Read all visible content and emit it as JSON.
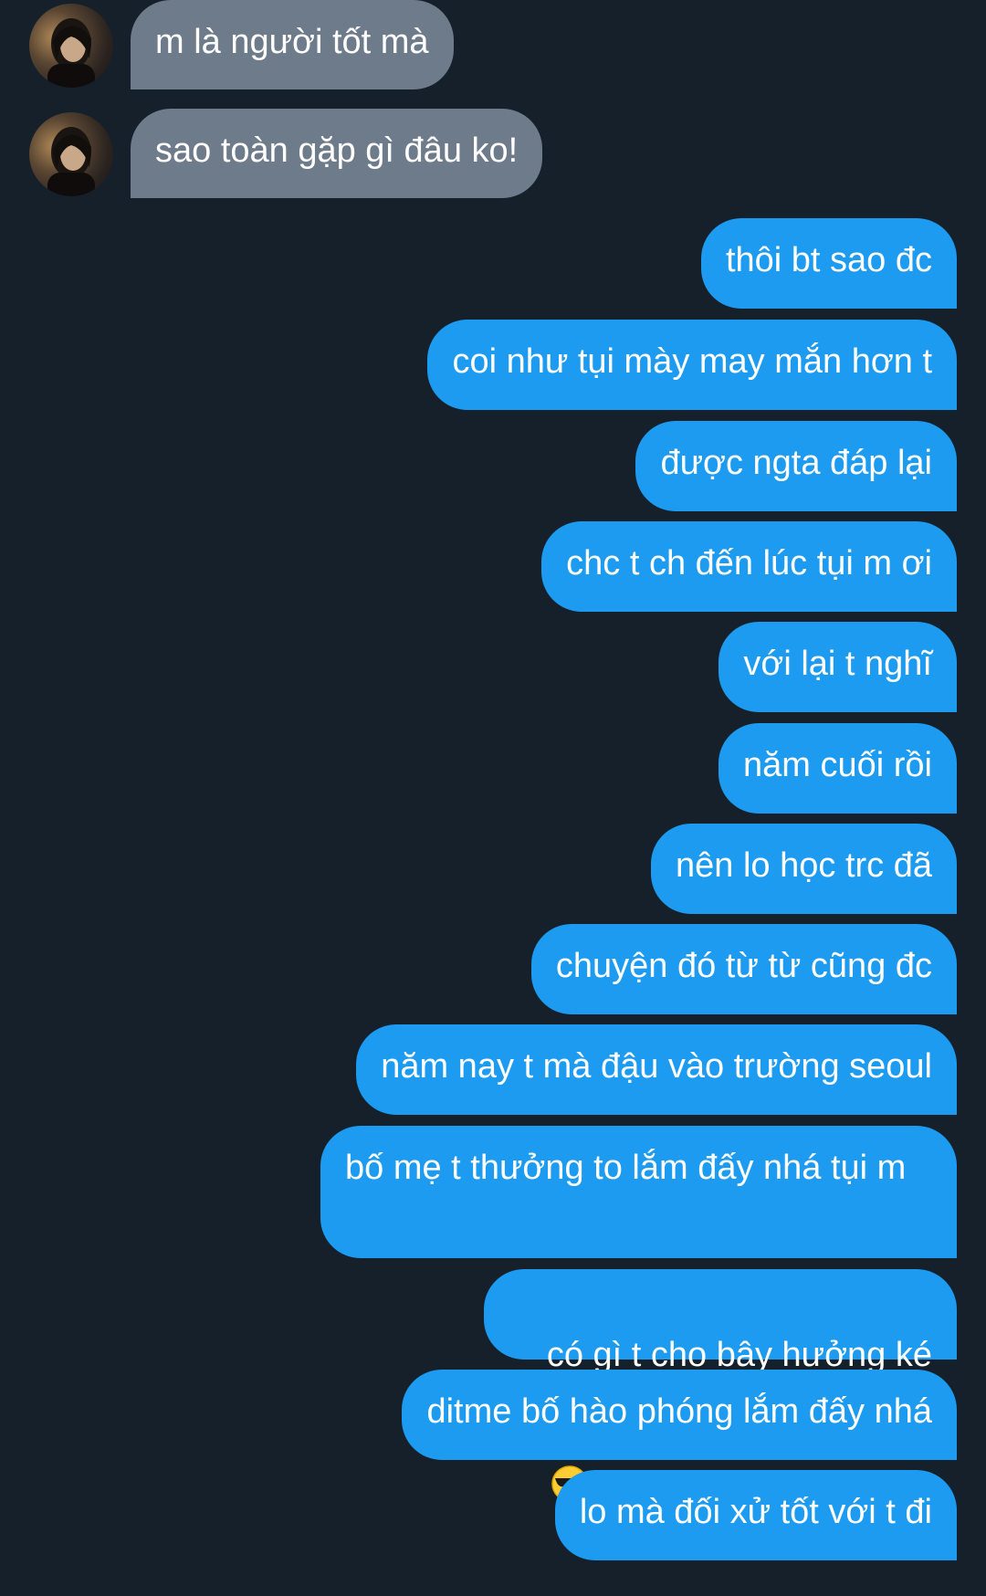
{
  "incoming": [
    {
      "text": "m là người tốt mà"
    },
    {
      "text": "sao toàn gặp gì đâu ko!"
    }
  ],
  "outgoing": [
    {
      "text": "thôi bt sao đc"
    },
    {
      "text": "coi như tụi mày may mắn hơn t"
    },
    {
      "text": "được ngta đáp lại"
    },
    {
      "text": "chc t ch đến lúc tụi m ơi"
    },
    {
      "text": "với lại t nghĩ"
    },
    {
      "text": "năm cuối rồi"
    },
    {
      "text": "nên lo học trc đã"
    },
    {
      "text": "chuyện đó từ từ cũng đc"
    },
    {
      "text": "năm nay t mà đậu vào trường seoul"
    },
    {
      "text": "bố mẹ t thưởng to lắm đấy nhá tụi m"
    },
    {
      "text": "có gì t cho bây hưởng ké",
      "emoji": "smiling-face-with-sunglasses"
    },
    {
      "text": "ditme bố hào phóng lắm đấy nhá"
    },
    {
      "text": "lo mà đối xử tốt với t đi"
    }
  ],
  "colors": {
    "background": "#15202b",
    "incoming_bubble": "#6e7b8a",
    "outgoing_bubble": "#1d9bf0",
    "text": "#ffffff"
  }
}
